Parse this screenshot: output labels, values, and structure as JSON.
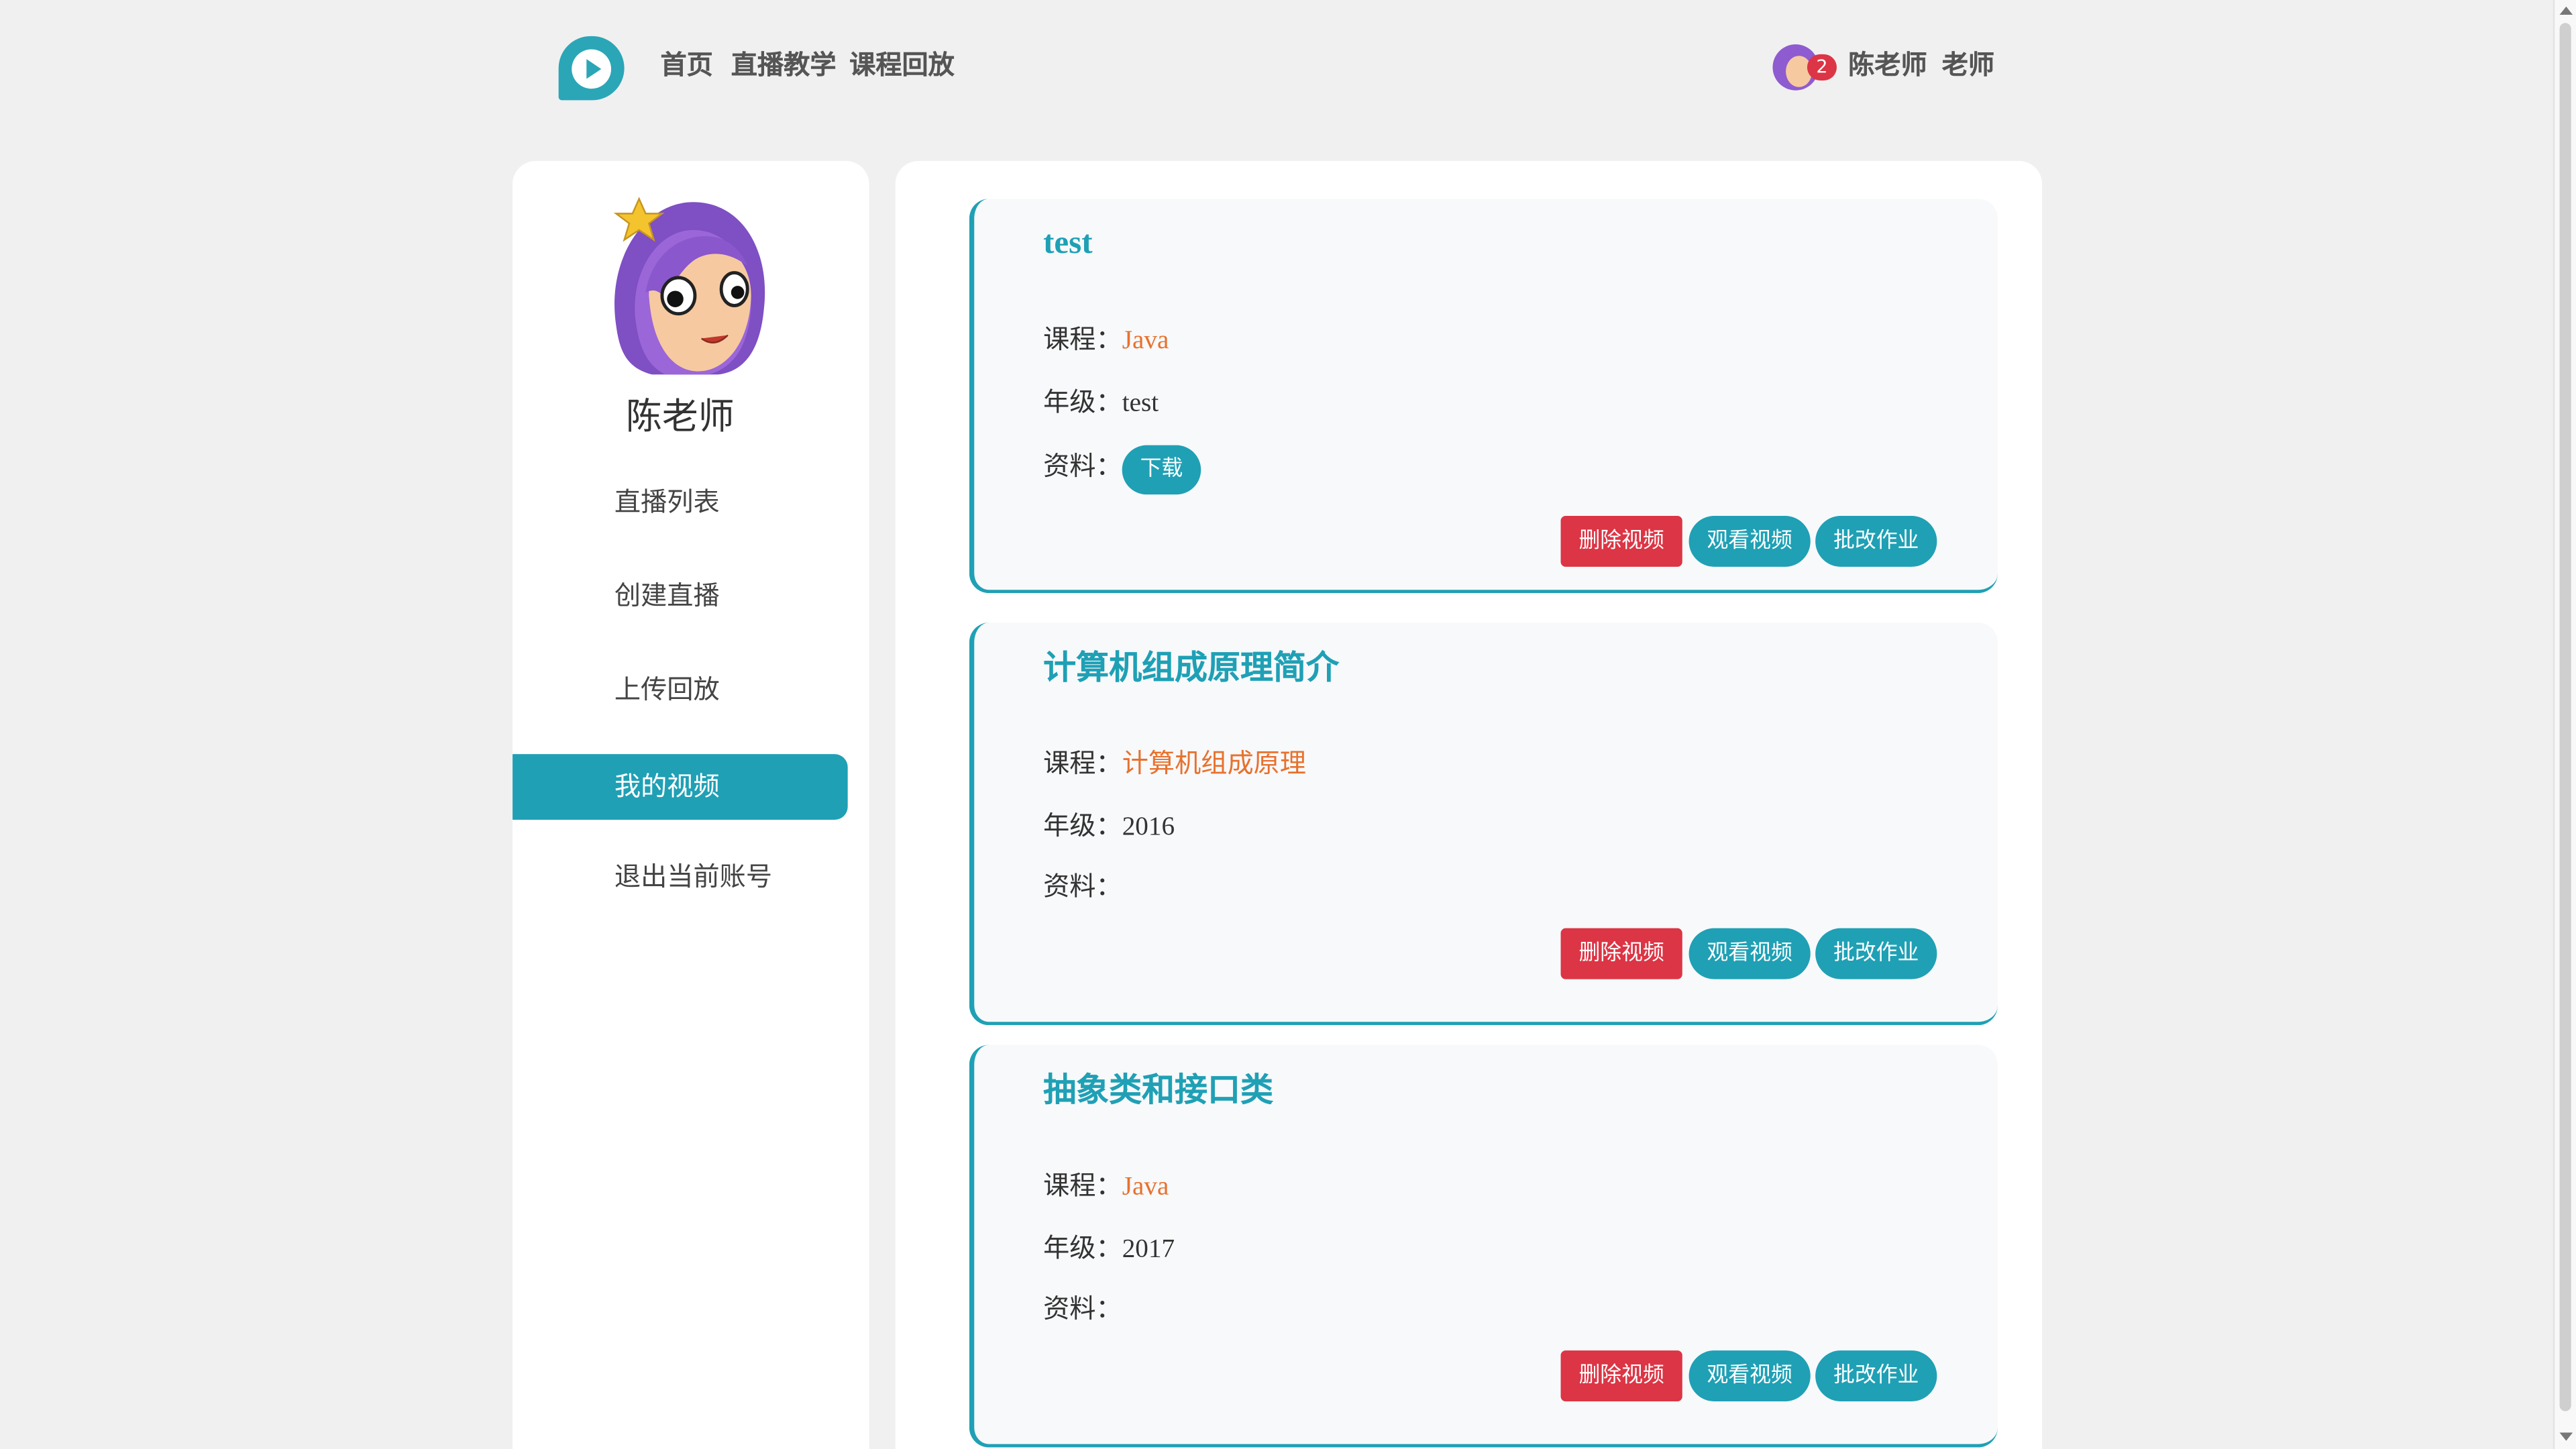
{
  "header": {
    "nav": [
      {
        "label": "首页"
      },
      {
        "label": "直播教学"
      },
      {
        "label": "课程回放"
      }
    ],
    "user": {
      "notification_count": "2",
      "name": "陈老师",
      "role": "老师"
    }
  },
  "sidebar": {
    "profile_name": "陈老师",
    "items": [
      {
        "label": "直播列表"
      },
      {
        "label": "创建直播"
      },
      {
        "label": "上传回放"
      },
      {
        "label": "我的视频",
        "active": true
      },
      {
        "label": "退出当前账号"
      }
    ]
  },
  "videos": [
    {
      "title": "test",
      "course_label": "课程：",
      "course": "Java",
      "grade_label": "年级：",
      "grade": "test",
      "material_label": "资料：",
      "download_label": "下载",
      "delete_label": "删除视频",
      "watch_label": "观看视频",
      "grade_hw_label": "批改作业"
    },
    {
      "title": "计算机组成原理简介",
      "course_label": "课程：",
      "course": "计算机组成原理",
      "grade_label": "年级：",
      "grade": "2016",
      "material_label": "资料：",
      "delete_label": "删除视频",
      "watch_label": "观看视频",
      "grade_hw_label": "批改作业"
    },
    {
      "title": "抽象类和接口类",
      "course_label": "课程：",
      "course": "Java",
      "grade_label": "年级：",
      "grade": "2017",
      "material_label": "资料：",
      "delete_label": "删除视频",
      "watch_label": "观看视频",
      "grade_hw_label": "批改作业"
    }
  ],
  "colors": {
    "accent": "#1fa0b5",
    "danger": "#dc3545",
    "course_text": "#e8712d",
    "background": "#f0f0f0"
  },
  "icons": {
    "logo": "play-logo-icon",
    "avatar": "cartoon-girl-avatar"
  }
}
